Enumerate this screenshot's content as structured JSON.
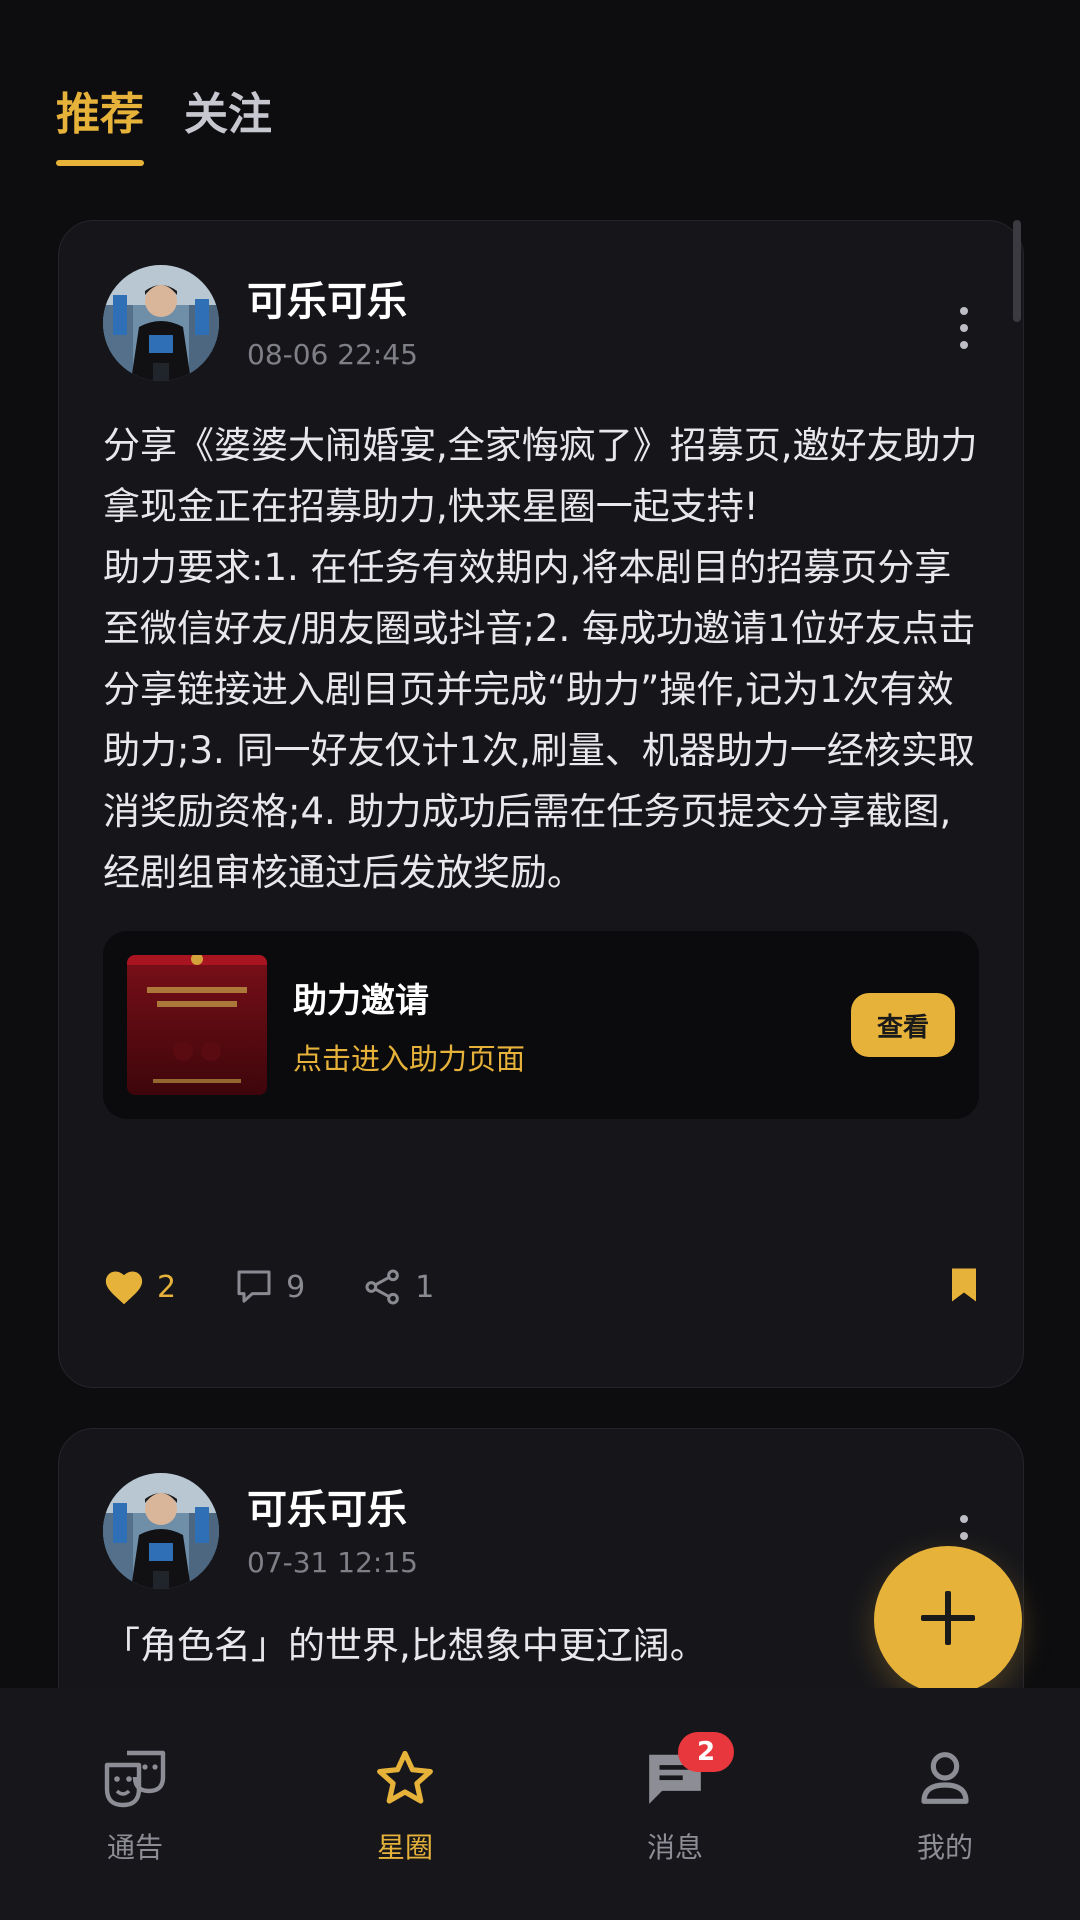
{
  "colors": {
    "accent": "#e6b23a",
    "background": "#0d0d10",
    "card": "#16161a",
    "badge": "#e8383d"
  },
  "top_tabs": [
    {
      "label": "推荐",
      "active": true
    },
    {
      "label": "关注",
      "active": false
    }
  ],
  "posts": [
    {
      "author": "可乐可乐",
      "time": "08-06 22:45",
      "text": "分享《婆婆大闹婚宴,全家悔疯了》招募页,邀好友助力拿现金正在招募助力,快来星圈一起支持!\n助力要求:1. 在任务有效期内,将本剧目的招募页分享至微信好友/朋友圈或抖音;2. 每成功邀请1位好友点击分享链接进入剧目页并完成“助力”操作,记为1次有效助力;3. 同一好友仅计1次,刷量、机器助力一经核实取消奖励资格;4. 助力成功后需在任务页提交分享截图,经剧组审核通过后发放奖励。",
      "invite": {
        "title": "助力邀请",
        "subtitle": "点击进入助力页面",
        "button": "查看"
      },
      "likes": "2",
      "comments": "9",
      "shares": "1",
      "liked": true,
      "bookmarked": true
    },
    {
      "author": "可乐可乐",
      "time": "07-31 12:15",
      "text": "「角色名」的世界,比想象中更辽阔。"
    }
  ],
  "fab": {
    "icon": "plus-icon"
  },
  "bottom_nav": [
    {
      "label": "通告",
      "icon": "theater-masks-icon",
      "active": false
    },
    {
      "label": "星圈",
      "icon": "star-icon",
      "active": true
    },
    {
      "label": "消息",
      "icon": "message-icon",
      "active": false,
      "badge": "2"
    },
    {
      "label": "我的",
      "icon": "person-icon",
      "active": false
    }
  ]
}
